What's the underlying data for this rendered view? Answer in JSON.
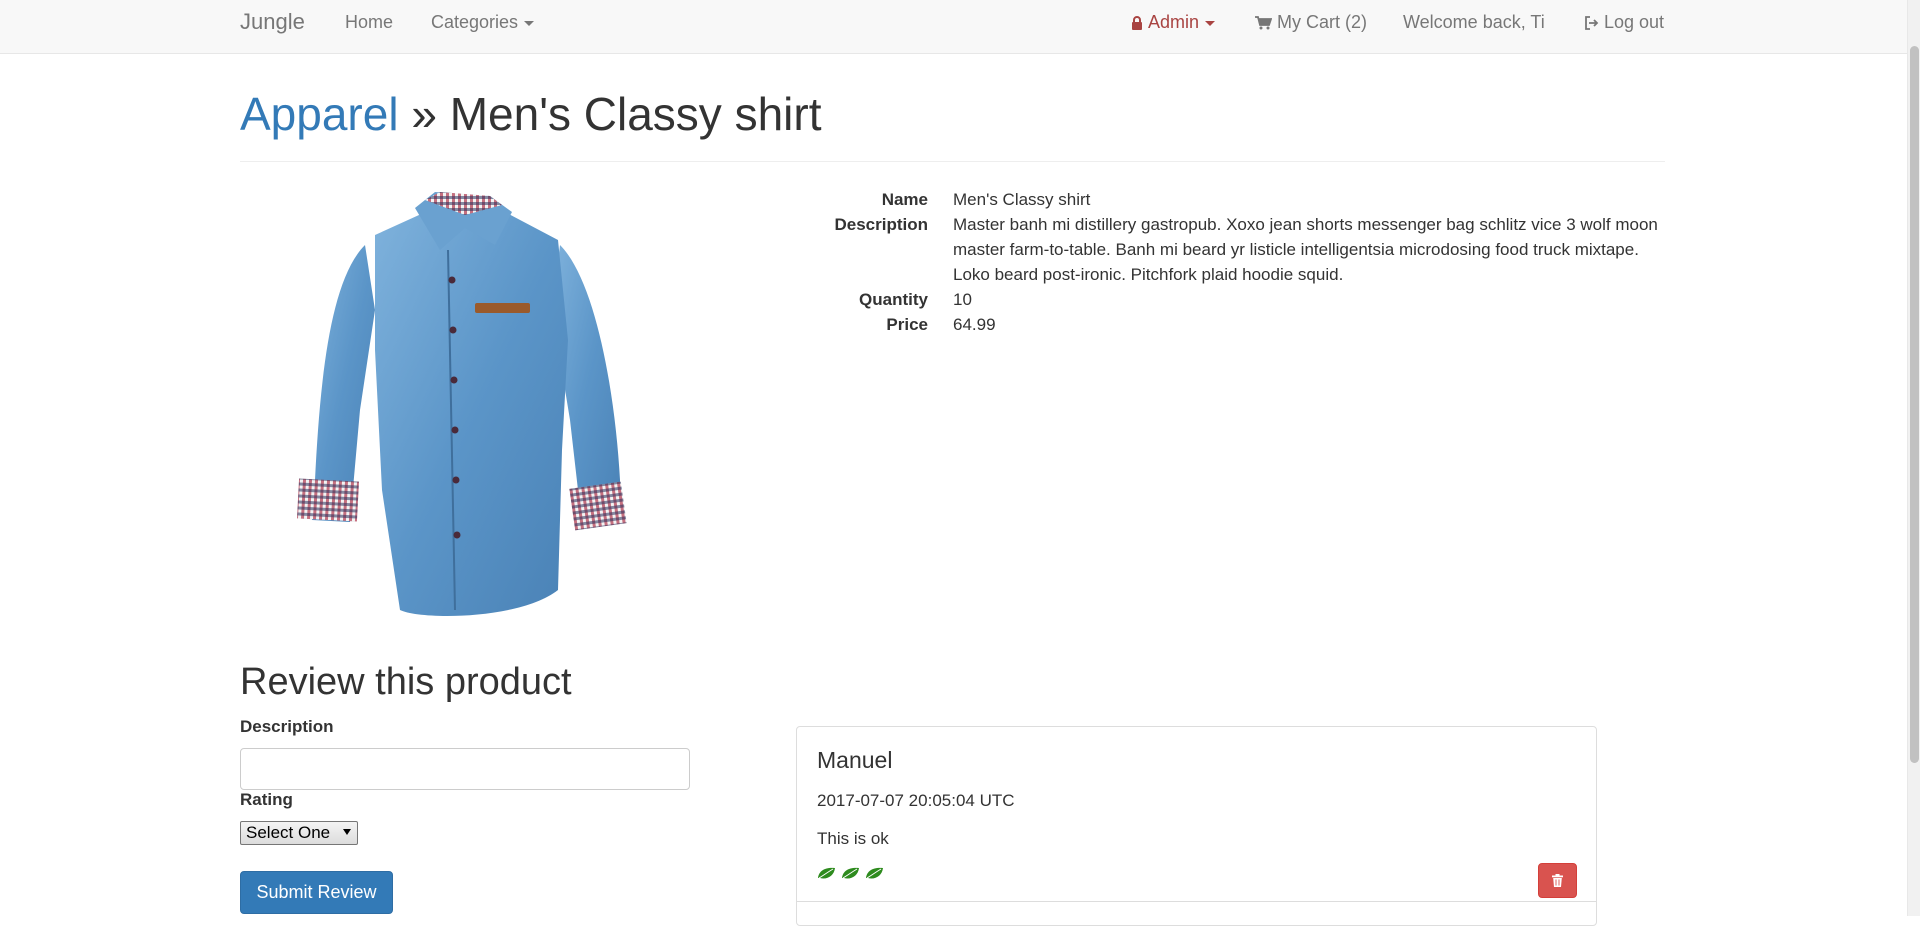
{
  "navbar": {
    "brand": "Jungle",
    "home": "Home",
    "categories": "Categories",
    "admin": "Admin",
    "cart": "My Cart (2)",
    "welcome": "Welcome back, Ti",
    "logout": "Log out"
  },
  "header": {
    "category": "Apparel",
    "separator": " » ",
    "product_name": "Men's Classy shirt"
  },
  "product": {
    "image_icon": "denim-shirt",
    "details": [
      {
        "label": "Name",
        "value": "Men's Classy shirt"
      },
      {
        "label": "Description",
        "value": "Master banh mi distillery gastropub. Xoxo jean shorts messenger bag schlitz vice 3 wolf moon master farm-to-table. Banh mi beard yr listicle intelligentsia microdosing food truck mixtape. Loko beard post-ironic. Pitchfork plaid hoodie squid."
      },
      {
        "label": "Quantity",
        "value": "10"
      },
      {
        "label": "Price",
        "value": "64.99"
      }
    ]
  },
  "review_form": {
    "heading": "Review this product",
    "description_label": "Description",
    "description_value": "",
    "rating_label": "Rating",
    "rating_selected": "Select One",
    "submit_label": "Submit Review"
  },
  "reviews": [
    {
      "author": "Manuel",
      "date": "2017-07-07 20:05:04 UTC",
      "text": "This is ok",
      "rating": 3,
      "rating_icon": "leaf-icon"
    }
  ],
  "colors": {
    "link": "#337ab7",
    "admin": "#a94442",
    "primary_button": "#337ab7",
    "danger_button": "#d9534f",
    "leaf": "#2e8b1e"
  }
}
